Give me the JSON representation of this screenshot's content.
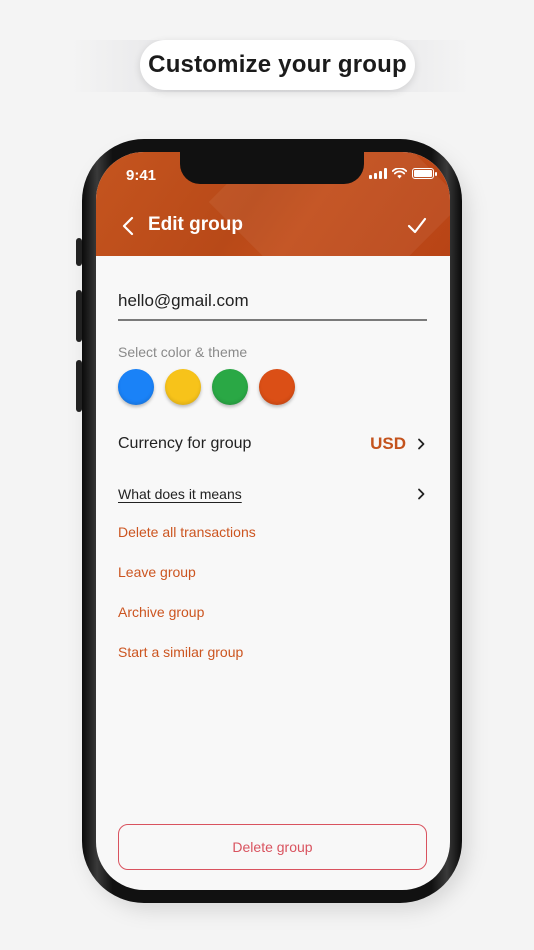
{
  "headline": "Customize your group",
  "status_bar": {
    "time": "9:41"
  },
  "header": {
    "title": "Edit group"
  },
  "form": {
    "email_value": "hello@gmail.com",
    "color_section_label": "Select color & theme",
    "swatch_colors": [
      "#1a82f7",
      "#f7c31a",
      "#2aa845",
      "#db4f16"
    ]
  },
  "currency": {
    "label": "Currency for group",
    "value": "USD"
  },
  "info_link": "What does it means",
  "actions": [
    "Delete all transactions",
    "Leave group",
    "Archive group",
    "Start a similar group"
  ],
  "delete_button": "Delete group",
  "colors": {
    "accent": "#c4531d",
    "header": "#b84918",
    "danger": "#d9535f"
  }
}
